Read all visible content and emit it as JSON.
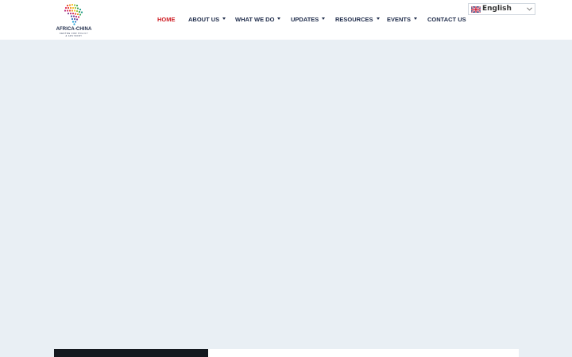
{
  "logo": {
    "name": "AFRICA-CHINA",
    "tagline": "CENTRE FOR POLICY & ADVISORY",
    "icon": "africa-dots-logo-icon"
  },
  "nav": {
    "items": [
      {
        "label": "HOME",
        "active": true,
        "dropdown": false
      },
      {
        "label": "ABOUT US",
        "active": false,
        "dropdown": true
      },
      {
        "label": "WHAT WE DO",
        "active": false,
        "dropdown": true
      },
      {
        "label": "UPDATES",
        "active": false,
        "dropdown": true
      },
      {
        "label": "RESOURCES",
        "active": false,
        "dropdown": true
      },
      {
        "label": "EVENTS",
        "active": false,
        "dropdown": true
      },
      {
        "label": "CONTACT US",
        "active": false,
        "dropdown": false
      }
    ]
  },
  "language": {
    "selected": "English",
    "flag_icon": "uk-flag-icon",
    "chevron_icon": "chevron-down-icon"
  },
  "colors": {
    "active_nav": "#cf1f26",
    "nav_text": "#1e2b4a",
    "hero_background": "#e9eff4",
    "bottom_panel_dark": "#14191f"
  }
}
